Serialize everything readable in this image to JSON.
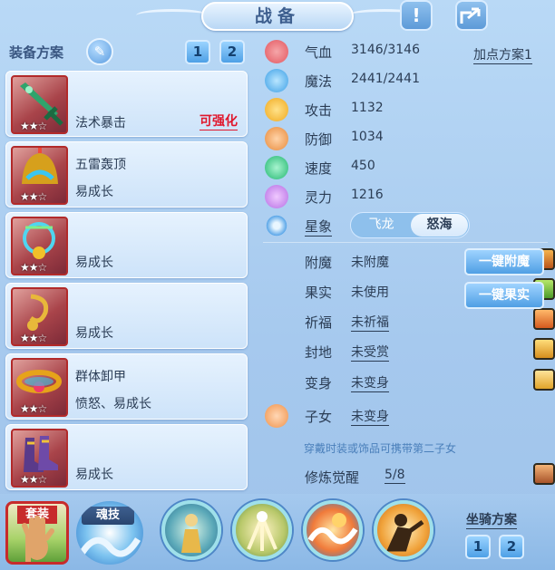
{
  "title": "战备",
  "left": {
    "plan_label": "装备方案",
    "plan_buttons": [
      "1",
      "2"
    ],
    "slots": [
      {
        "name": "",
        "tag": "法术暴击",
        "enhance": "可强化",
        "stars": "★★☆"
      },
      {
        "name": "五雷轰顶",
        "tag": "易成长",
        "stars": "★★☆"
      },
      {
        "name": "",
        "tag": "易成长",
        "stars": "★★☆"
      },
      {
        "name": "",
        "tag": "易成长",
        "stars": "★★☆"
      },
      {
        "name": "群体卸甲",
        "tag": "愤怒、易成长",
        "stars": "★★☆"
      },
      {
        "name": "",
        "tag": "易成长",
        "stars": "★★☆"
      }
    ]
  },
  "stats": [
    {
      "name": "气血",
      "value": "3146/3146"
    },
    {
      "name": "魔法",
      "value": "2441/2441"
    },
    {
      "name": "攻击",
      "value": "1132"
    },
    {
      "name": "防御",
      "value": "1034"
    },
    {
      "name": "速度",
      "value": "450"
    },
    {
      "name": "灵力",
      "value": "1216"
    }
  ],
  "point_plan": "加点方案1",
  "star_sign": {
    "label": "星象",
    "options": [
      "飞龙",
      "怒海"
    ],
    "selected": "怒海"
  },
  "extras": [
    {
      "name": "附魔",
      "value": "未附魔"
    },
    {
      "name": "果实",
      "value": "未使用"
    },
    {
      "name": "祈福",
      "value": "未祈福"
    },
    {
      "name": "封地",
      "value": "未受赏"
    },
    {
      "name": "变身",
      "value": "未变身"
    },
    {
      "name": "子女",
      "value": "未变身"
    }
  ],
  "action_buttons": [
    "一键附魔",
    "一键果实"
  ],
  "hint": "穿戴时装或饰品可携带第二子女",
  "cultivation": {
    "name": "修炼觉醒",
    "value": "5/8"
  },
  "bottom": {
    "set_label": "套装",
    "soul_label": "魂技",
    "ride_label": "坐骑方案",
    "ride_buttons": [
      "1",
      "2"
    ]
  }
}
